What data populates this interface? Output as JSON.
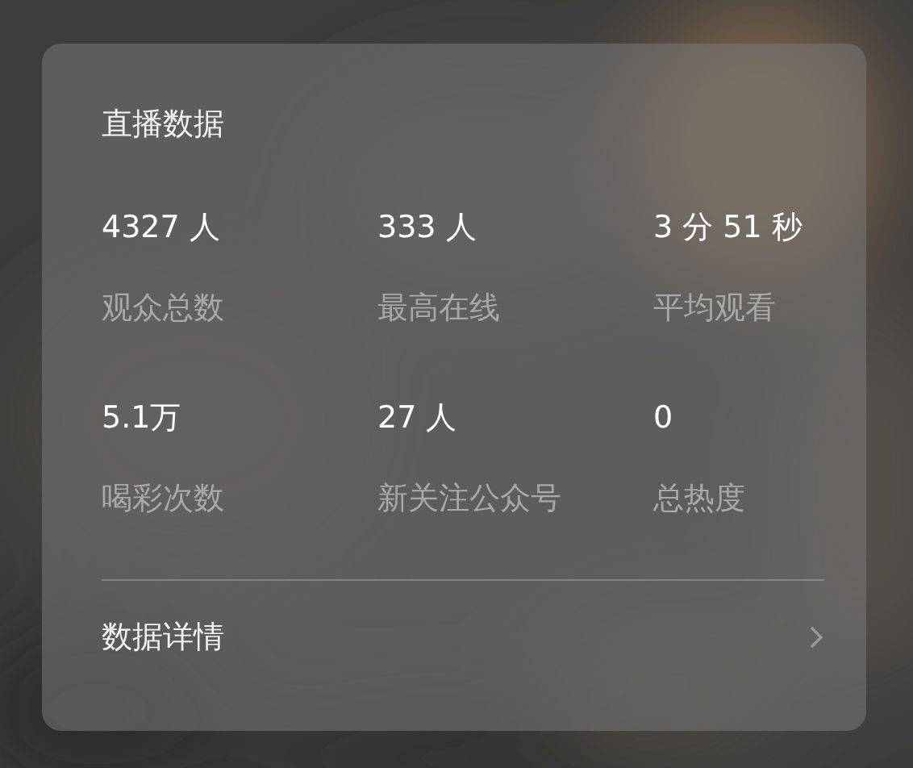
{
  "title": "直播数据",
  "stats": [
    {
      "value": "4327 人",
      "label": "观众总数"
    },
    {
      "value": "333 人",
      "label": "最高在线"
    },
    {
      "value": "3 分 51 秒",
      "label": "平均观看"
    },
    {
      "value": "5.1万",
      "label": "喝彩次数"
    },
    {
      "value": "27 人",
      "label": "新关注公众号"
    },
    {
      "value": "0",
      "label": "总热度"
    }
  ],
  "footer": {
    "label": "数据详情"
  }
}
